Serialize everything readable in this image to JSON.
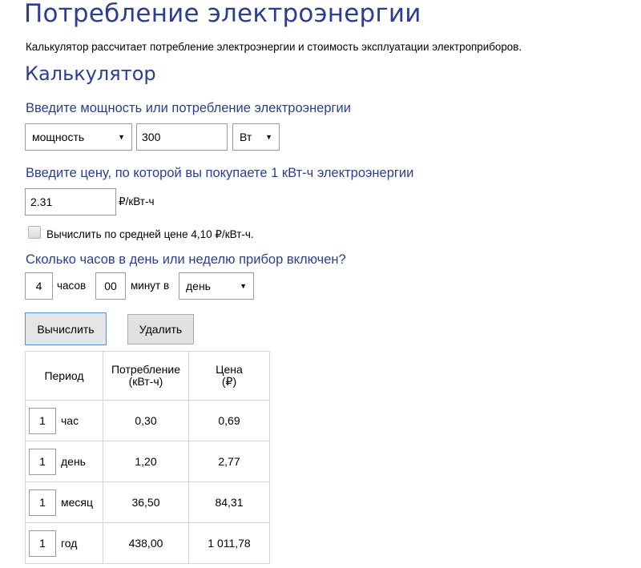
{
  "page": {
    "title": "Потребление электроэнергии",
    "subtitle": "Калькулятор рассчитает потребление электроэнергии и стоимость эксплуатации электроприборов.",
    "section_title": "Калькулятор"
  },
  "power": {
    "prompt": "Введите мощность или потребление электроэнергии",
    "mode_value": "мощность",
    "amount_value": "300",
    "unit_value": "Вт"
  },
  "price": {
    "prompt": "Введите цену, по которой вы покупаете 1 кВт-ч электроэнергии",
    "value": "2.31",
    "unit": "₽/кВт-ч",
    "average_label": "Вычислить по средней цене 4,10 ₽/кВт-ч."
  },
  "usage": {
    "prompt": "Сколько часов в день или неделю прибор включен?",
    "hours_value": "4",
    "hours_label": "часов",
    "minutes_value": "00",
    "minutes_label": "минут в",
    "period_value": "день"
  },
  "buttons": {
    "calculate": "Вычислить",
    "delete": "Удалить"
  },
  "results": {
    "headers": {
      "period": "Период",
      "consumption_line1": "Потребление",
      "consumption_line2": "(кВт-ч)",
      "price_line1": "Цена",
      "price_line2": "(₽)"
    },
    "rows": [
      {
        "count": "1",
        "period": "час",
        "consumption": "0,30",
        "price": "0,69"
      },
      {
        "count": "1",
        "period": "день",
        "consumption": "1,20",
        "price": "2,77"
      },
      {
        "count": "1",
        "period": "месяц",
        "consumption": "36,50",
        "price": "84,31"
      },
      {
        "count": "1",
        "period": "год",
        "consumption": "438,00",
        "price": "1 011,78"
      }
    ]
  }
}
